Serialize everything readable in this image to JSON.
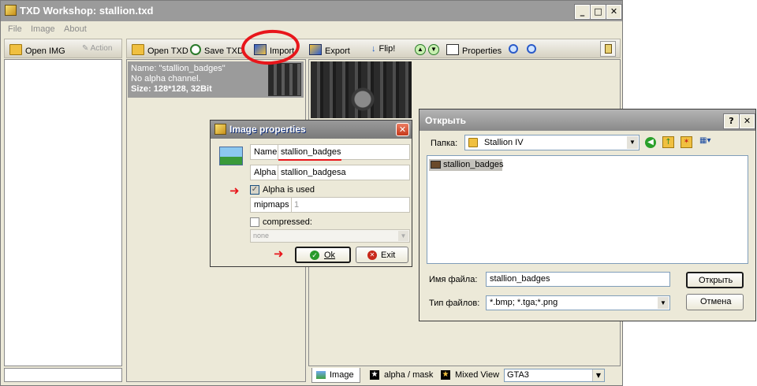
{
  "main_window": {
    "title": "TXD Workshop: stallion.txd",
    "menu": [
      "File",
      "Image",
      "About"
    ],
    "left_toolbar": {
      "open_img": "Open IMG",
      "action": "Action"
    },
    "toolbar": {
      "open_txd": "Open TXD",
      "save_txd": "Save TXD",
      "import": "Import",
      "export": "Export",
      "flip": "Flip!",
      "properties": "Properties"
    },
    "texture_item": {
      "name_line": "Name: \"stallion_badges\"",
      "alpha_line": "No alpha channel.",
      "size_line": "Size: 128*128, 32Bit"
    },
    "bottom_tabs": [
      "Image",
      "alpha / mask",
      "Mixed View"
    ],
    "game_select": "GTA3"
  },
  "image_properties": {
    "title": "Image properties",
    "name_label": "Name",
    "name_value": "stallion_badges",
    "alpha_label": "Alpha",
    "alpha_value": "stallion_badgesa",
    "alpha_used_label": "Alpha is used",
    "alpha_used_checked": true,
    "mipmaps_label": "mipmaps",
    "mipmaps_value": "1",
    "compressed_label": "compressed:",
    "compressed_checked": false,
    "compression_select": "none",
    "ok_label": "Ok",
    "exit_label": "Exit"
  },
  "open_dialog": {
    "title": "Открыть",
    "folder_label": "Папка:",
    "folder_value": "Stallion IV",
    "files": [
      "stallion_badges"
    ],
    "filename_label": "Имя файла:",
    "filename_value": "stallion_badges",
    "filetype_label": "Тип файлов:",
    "filetype_value": "*.bmp; *.tga;*.png",
    "open_button": "Открыть",
    "cancel_button": "Отмена"
  },
  "annotations": {
    "highlight_color": "#e8161b"
  },
  "icons": [
    "folder-icon",
    "save-icon",
    "import-icon",
    "export-icon",
    "flip-icon",
    "up-arrow-icon",
    "down-arrow-icon",
    "properties-icon",
    "zoom-in-icon",
    "zoom-out-icon",
    "clipboard-icon",
    "help-icon",
    "close-icon",
    "back-icon",
    "parent-folder-icon",
    "new-folder-icon",
    "view-menu-icon",
    "picture-icon"
  ]
}
